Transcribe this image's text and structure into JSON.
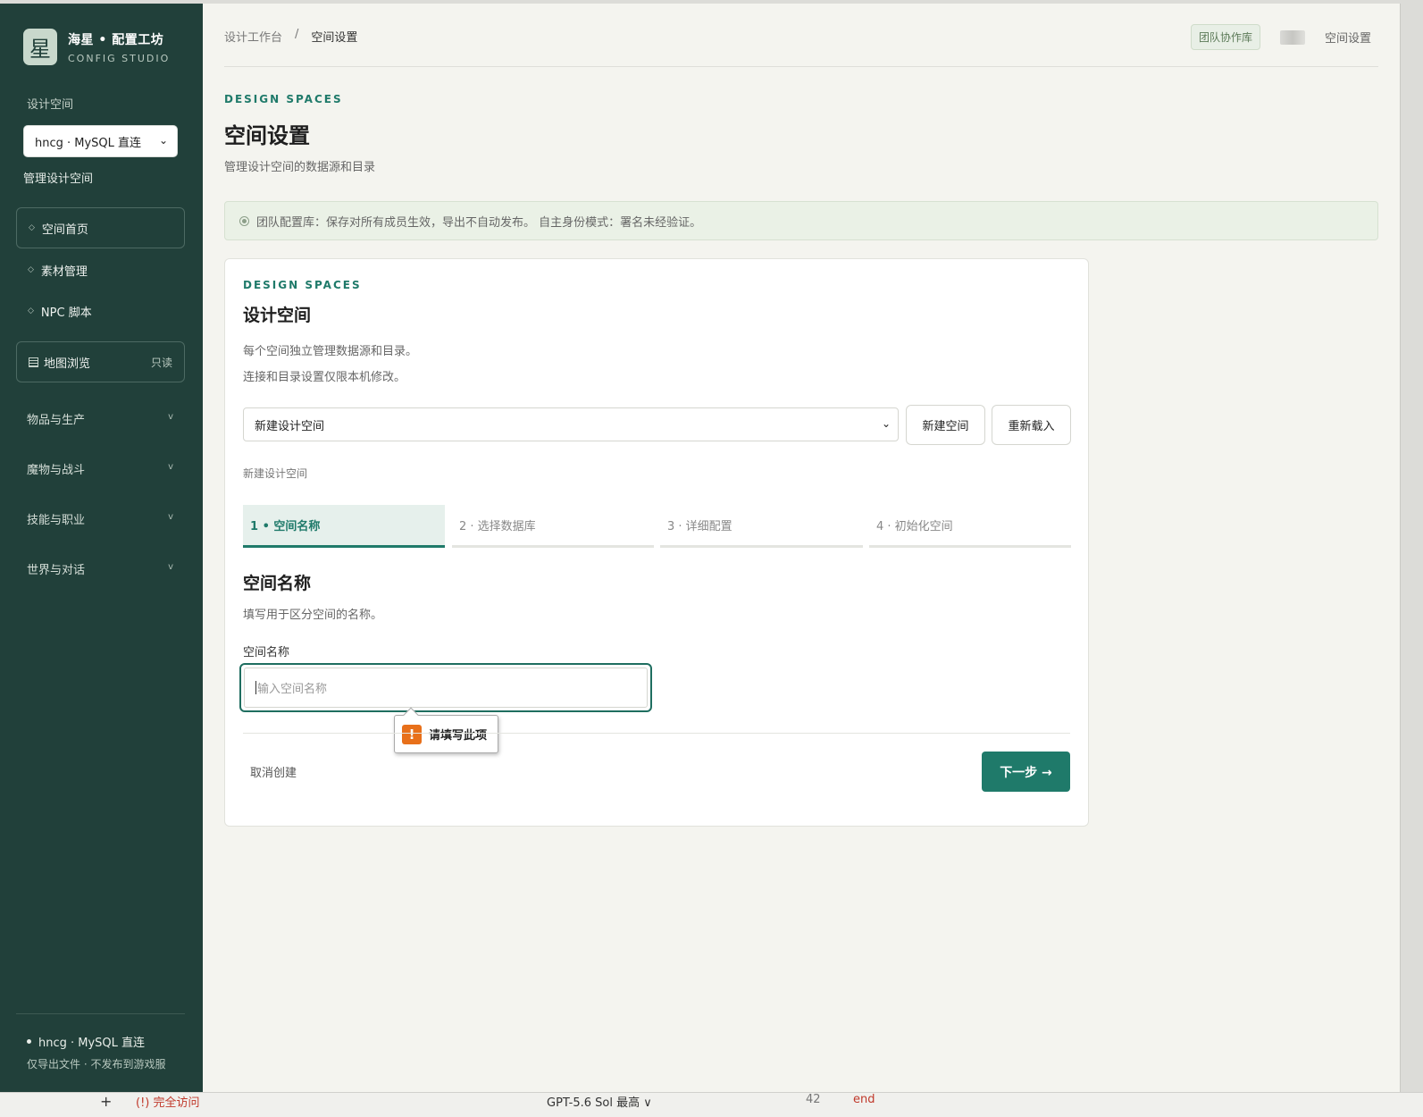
{
  "brand": {
    "logo_char": "星",
    "title": "海星 • 配置工坊",
    "subtitle": "CONFIG STUDIO"
  },
  "sidebar": {
    "section_label": "设计空间",
    "workspace_select": {
      "value": "hncg · MySQL 直连"
    },
    "manage_link": "管理设计空间",
    "nav": [
      {
        "label": "空间首页",
        "active": true
      },
      {
        "label": "素材管理"
      },
      {
        "label": "NPC 脚本"
      }
    ],
    "map_browse": {
      "label": "地图浏览",
      "badge": "只读"
    },
    "groups": [
      "物品与生产",
      "魔物与战斗",
      "技能与职业",
      "世界与对话"
    ],
    "connection": {
      "label": "hncg · MySQL 直连",
      "note": "仅导出文件 · 不发布到游戏服"
    }
  },
  "header": {
    "breadcrumb": [
      "设计工作台",
      "/",
      "空间设置"
    ],
    "team_badge": "团队协作库",
    "settings_link": "空间设置"
  },
  "page": {
    "eyebrow": "DESIGN SPACES",
    "title": "空间设置",
    "subtitle": "管理设计空间的数据源和目录",
    "notice": "团队配置库：保存对所有成员生效，导出不自动发布。 自主身份模式：署名未经验证。"
  },
  "card": {
    "eyebrow": "DESIGN SPACES",
    "title": "设计空间",
    "desc1": "每个空间独立管理数据源和目录。",
    "desc2": "连接和目录设置仅限本机修改。",
    "space_select": {
      "value": "新建设计空间"
    },
    "new_button": "新建空间",
    "reload_button": "重新载入",
    "mode_label": "新建设计空间",
    "steps": [
      "1 • 空间名称",
      "2 · 选择数据库",
      "3 · 详细配置",
      "4 · 初始化空间"
    ],
    "section_title": "空间名称",
    "section_desc": "填写用于区分空间的名称。",
    "field_label": "空间名称",
    "field_placeholder": "输入空间名称",
    "field_value": "",
    "tooltip": {
      "icon": "!",
      "text": "请填写此项"
    },
    "cancel": "取消创建",
    "next": "下一步 →"
  },
  "taskbar": {
    "items": [
      "+",
      "(!) 完全访问",
      "GPT-5.6 Sol 最高 ∨",
      "42",
      "end"
    ]
  },
  "colors": {
    "sidebar_bg": "#21403a",
    "accent": "#1f7a6a",
    "warning": "#e8701a",
    "notice_bg": "#eaf1e6"
  }
}
